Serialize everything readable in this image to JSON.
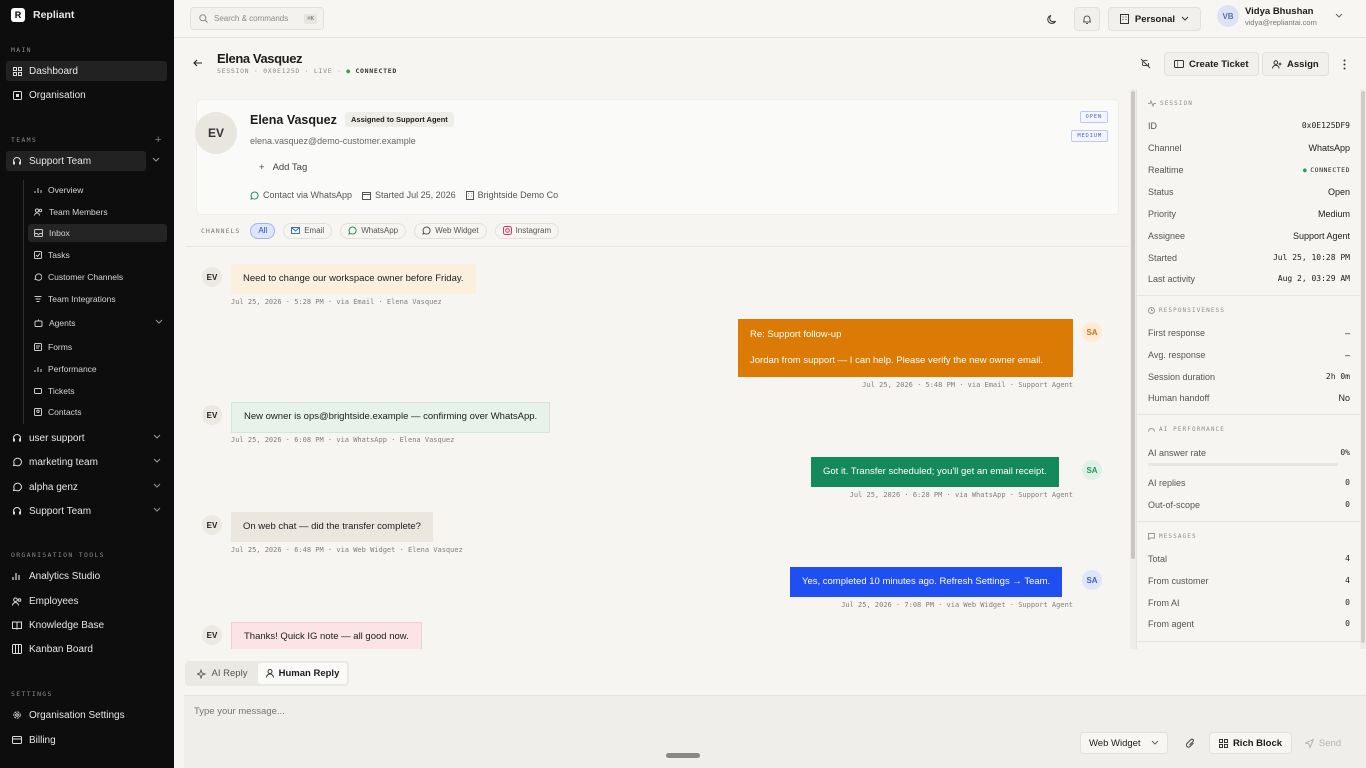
{
  "app": {
    "name": "Repliant",
    "logo_letter": "R"
  },
  "sidebar": {
    "main_label": "MAIN",
    "main_items": [
      {
        "label": "Dashboard",
        "icon": "dashboard-icon"
      },
      {
        "label": "Organisation",
        "icon": "organisation-icon"
      }
    ],
    "teams_label": "TEAMS",
    "team_active": "Support Team",
    "team_subitems": [
      "Overview",
      "Team Members",
      "Inbox",
      "Tasks",
      "Customer Channels",
      "Team Integrations",
      "Agents",
      "Forms",
      "Performance",
      "Tickets",
      "Contacts"
    ],
    "other_teams": [
      "user support",
      "marketing team",
      "alpha genz",
      "Support Team"
    ],
    "tools_label": "ORGANISATION TOOLS",
    "tools": [
      "Analytics Studio",
      "Employees",
      "Knowledge Base",
      "Kanban Board"
    ],
    "settings_label": "SETTINGS",
    "settings": [
      "Organisation Settings",
      "Billing"
    ]
  },
  "topbar": {
    "search_placeholder": "Search & commands",
    "search_shortcut": "⌘K",
    "workspace": "Personal",
    "user_initials": "VB",
    "user_name": "Vidya Bhushan",
    "user_email": "vidya@repliantai.com"
  },
  "header": {
    "name": "Elena Vasquez",
    "session_label": "SESSION · 0X0E125D · LIVE ·",
    "status": "CONNECTED",
    "create_ticket": "Create Ticket",
    "assign": "Assign"
  },
  "contact": {
    "initials": "EV",
    "name": "Elena Vasquez",
    "assigned_badge": "Assigned to Support Agent",
    "email": "elena.vasquez@demo-customer.example",
    "add_tag": "Add Tag",
    "contact_via": "Contact via WhatsApp",
    "started": "Started Jul 25, 2026",
    "company": "Brightside Demo Co",
    "status_tag": "OPEN",
    "priority_tag": "MEDIUM"
  },
  "channels": {
    "label": "CHANNELS",
    "items": [
      "All",
      "Email",
      "WhatsApp",
      "Web Widget",
      "Instagram"
    ]
  },
  "messages": [
    {
      "who": "EV",
      "text": "Need to change our workspace owner before Friday.",
      "meta": "Jul 25, 2026 · 5:28 PM · via Email · Elena Vasquez"
    },
    {
      "who": "SA",
      "subject": "Re: Support follow-up",
      "text": "Jordan from support — I can help. Please verify the new owner email.",
      "meta": "Jul 25, 2026 · 5:48 PM · via Email · Support Agent"
    },
    {
      "who": "EV",
      "text": "New owner is ops@brightside.example — confirming over WhatsApp.",
      "meta": "Jul 25, 2026 · 6:08 PM · via WhatsApp · Elena Vasquez"
    },
    {
      "who": "SA",
      "text": "Got it. Transfer scheduled; you'll get an email receipt.",
      "meta": "Jul 25, 2026 · 6:28 PM · via WhatsApp · Support Agent"
    },
    {
      "who": "EV",
      "text": "On web chat — did the transfer complete?",
      "meta": "Jul 25, 2026 · 6:48 PM · via Web Widget · Elena Vasquez"
    },
    {
      "who": "SA",
      "text": "Yes, completed 10 minutes ago. Refresh Settings → Team.",
      "meta": "Jul 25, 2026 · 7:08 PM · via Web Widget · Support Agent"
    },
    {
      "who": "EV",
      "text": "Thanks! Quick IG note — all good now."
    }
  ],
  "panel": {
    "session_label": "SESSION",
    "session": [
      {
        "k": "ID",
        "v": "0x0E125DF9"
      },
      {
        "k": "Channel",
        "v": "WhatsApp"
      },
      {
        "k": "Realtime",
        "v": "CONNECTED"
      },
      {
        "k": "Status",
        "v": "Open"
      },
      {
        "k": "Priority",
        "v": "Medium"
      },
      {
        "k": "Assignee",
        "v": "Support Agent"
      },
      {
        "k": "Started",
        "v": "Jul 25, 10:28 PM"
      },
      {
        "k": "Last activity",
        "v": "Aug 2, 03:29 AM"
      }
    ],
    "resp_label": "RESPONSIVENESS",
    "resp": [
      {
        "k": "First response",
        "v": "–"
      },
      {
        "k": "Avg. response",
        "v": "–"
      },
      {
        "k": "Session duration",
        "v": "2h 0m"
      },
      {
        "k": "Human handoff",
        "v": "No"
      }
    ],
    "ai_label": "AI PERFORMANCE",
    "ai": [
      {
        "k": "AI answer rate",
        "v": "0%"
      },
      {
        "k": "AI replies",
        "v": "0"
      },
      {
        "k": "Out-of-scope",
        "v": "0"
      }
    ],
    "ai_answer_rate_fraction": 0,
    "msg_label": "MESSAGES",
    "msgs": [
      {
        "k": "Total",
        "v": "4"
      },
      {
        "k": "From customer",
        "v": "4"
      },
      {
        "k": "From AI",
        "v": "0"
      },
      {
        "k": "From agent",
        "v": "0"
      }
    ]
  },
  "composer": {
    "ai_reply": "AI Reply",
    "human_reply": "Human Reply",
    "placeholder": "Type your message...",
    "channel": "Web Widget",
    "rich_block": "Rich Block",
    "send": "Send"
  },
  "colors": {
    "email_bubble": "#dc7a06",
    "whatsapp_bubble": "#148a5a",
    "widget_bubble": "#1f4ff0",
    "connected": "#2e9e5b"
  }
}
